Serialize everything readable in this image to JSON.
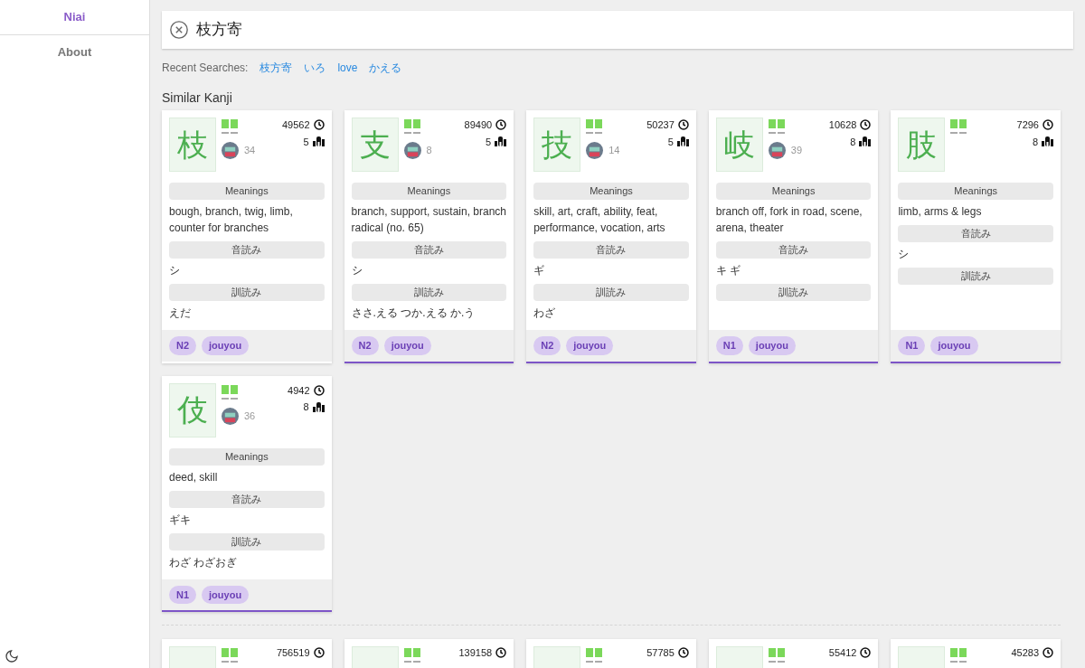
{
  "sidebar": {
    "items": [
      {
        "label": "Niai",
        "selected": true
      },
      {
        "label": "About",
        "selected": false
      }
    ]
  },
  "search": {
    "value": "枝方寄"
  },
  "recent_searches": {
    "label": "Recent Searches:",
    "items": [
      "枝方寄",
      "いろ",
      "love",
      "かえる"
    ]
  },
  "section_title": "Similar Kanji",
  "cards": [
    {
      "kanji": "枝",
      "avatar_count": "34",
      "frequency": "49562",
      "strokes": "5",
      "highlighted": false,
      "sections": [
        {
          "heading": "Meanings",
          "text": "bough, branch, twig, limb, counter for branches"
        },
        {
          "heading": "音読み",
          "text": "シ"
        },
        {
          "heading": "訓読み",
          "text": "えだ"
        }
      ],
      "tags": [
        "N2",
        "jouyou"
      ]
    },
    {
      "kanji": "支",
      "avatar_count": "8",
      "frequency": "89490",
      "strokes": "5",
      "highlighted": true,
      "sections": [
        {
          "heading": "Meanings",
          "text": "branch, support, sustain, branch radical (no. 65)"
        },
        {
          "heading": "音読み",
          "text": "シ"
        },
        {
          "heading": "訓読み",
          "text": "ささ.える つか.える か.う"
        }
      ],
      "tags": [
        "N2",
        "jouyou"
      ]
    },
    {
      "kanji": "技",
      "avatar_count": "14",
      "frequency": "50237",
      "strokes": "5",
      "highlighted": true,
      "sections": [
        {
          "heading": "Meanings",
          "text": "skill, art, craft, ability, feat, performance, vocation, arts"
        },
        {
          "heading": "音読み",
          "text": "ギ"
        },
        {
          "heading": "訓読み",
          "text": "わざ"
        }
      ],
      "tags": [
        "N2",
        "jouyou"
      ]
    },
    {
      "kanji": "岐",
      "avatar_count": "39",
      "frequency": "10628",
      "strokes": "8",
      "highlighted": true,
      "sections": [
        {
          "heading": "Meanings",
          "text": "branch off, fork in road, scene, arena, theater"
        },
        {
          "heading": "音読み",
          "text": "キ ギ"
        },
        {
          "heading": "訓読み"
        }
      ],
      "tags": [
        "N1",
        "jouyou"
      ]
    },
    {
      "kanji": "肢",
      "frequency": "7296",
      "strokes": "8",
      "highlighted": true,
      "sections": [
        {
          "heading": "Meanings",
          "text": "limb, arms & legs"
        },
        {
          "heading": "音読み",
          "text": "シ"
        },
        {
          "heading": "訓読み"
        }
      ],
      "tags": [
        "N1",
        "jouyou"
      ]
    },
    {
      "kanji": "伎",
      "avatar_count": "36",
      "frequency": "4942",
      "strokes": "8",
      "highlighted": true,
      "sections": [
        {
          "heading": "Meanings",
          "text": "deed, skill"
        },
        {
          "heading": "音読み",
          "text": "ギキ"
        },
        {
          "heading": "訓読み",
          "text": "わざ わざおぎ"
        }
      ],
      "tags": [
        "N1",
        "jouyou"
      ]
    }
  ],
  "more_cards": [
    {
      "frequency": "756519"
    },
    {
      "frequency": "139158"
    },
    {
      "frequency": "57785"
    },
    {
      "frequency": "55412"
    },
    {
      "frequency": "45283"
    }
  ]
}
